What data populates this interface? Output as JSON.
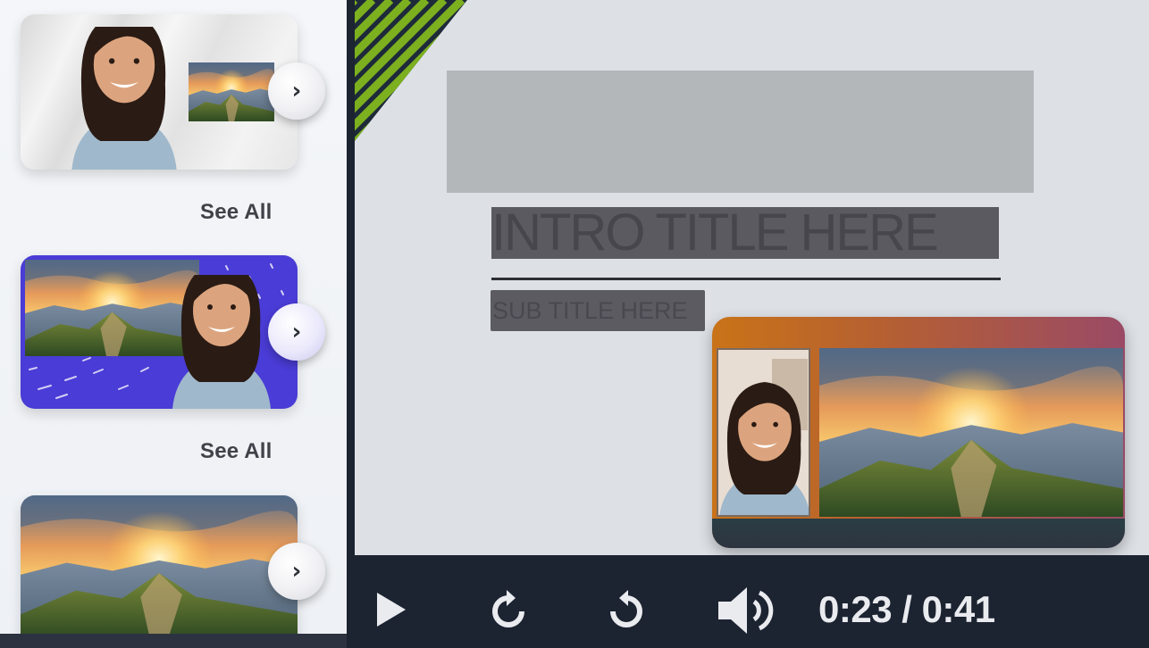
{
  "sidebar": {
    "see_all_1": "See All",
    "see_all_2": "See All",
    "cards": [
      {
        "layout": "webcam-with-picture-in-picture"
      },
      {
        "layout": "picture-with-webcam-overlay"
      },
      {
        "layout": "full-picture"
      }
    ],
    "next_icon": "chevron-right-icon"
  },
  "preview": {
    "intro_title": "INTRO TITLE HERE",
    "sub_title": "SUB TITLE  HERE"
  },
  "player": {
    "time": "0:23 / 0:41",
    "elapsed_seconds": 23,
    "duration_seconds": 41,
    "icons": [
      "play-icon",
      "replay-icon",
      "forward-icon",
      "volume-icon"
    ]
  },
  "colors": {
    "accent_green": "#7cb01f",
    "stripe_dark": "#1e2a3a",
    "stage_bg": "#dde1e6",
    "controls_bg": "#1c2331",
    "card_purple": "#4a3cd6"
  }
}
